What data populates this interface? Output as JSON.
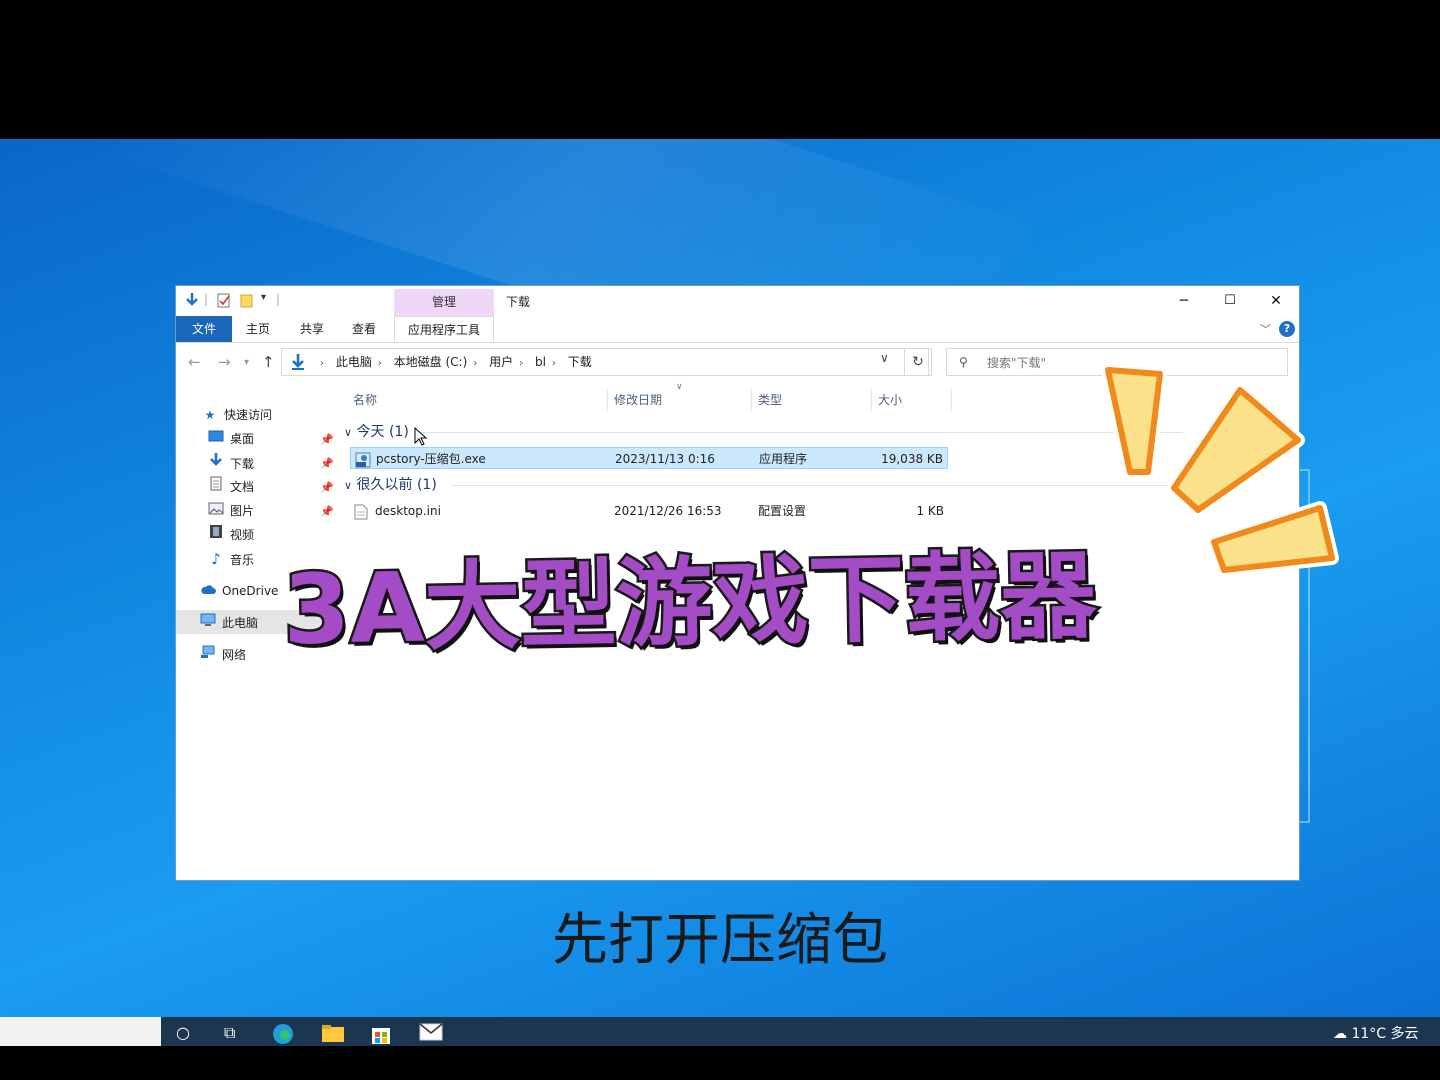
{
  "window": {
    "title": "下载",
    "context_tab_group": "管理",
    "controls": {
      "minimize": "─",
      "maximize": "☐",
      "close": "✕"
    }
  },
  "ribbon": {
    "tabs": [
      "文件",
      "主页",
      "共享",
      "查看",
      "应用程序工具"
    ],
    "help": "?"
  },
  "address": {
    "crumbs": [
      "此电脑",
      "本地磁盘 (C:)",
      "用户",
      "bl",
      "下载"
    ]
  },
  "search": {
    "placeholder": "搜索\"下载\""
  },
  "sidebar": {
    "items": [
      {
        "label": "快速访问",
        "icon": "star-icon",
        "pinned": false
      },
      {
        "label": "桌面",
        "icon": "desktop-icon",
        "pinned": true
      },
      {
        "label": "下载",
        "icon": "download-icon",
        "pinned": true
      },
      {
        "label": "文档",
        "icon": "document-icon",
        "pinned": true
      },
      {
        "label": "图片",
        "icon": "picture-icon",
        "pinned": true
      },
      {
        "label": "视频",
        "icon": "video-icon",
        "pinned": false
      },
      {
        "label": "音乐",
        "icon": "music-icon",
        "pinned": false
      },
      {
        "label": "OneDrive",
        "icon": "cloud-icon",
        "pinned": false
      },
      {
        "label": "此电脑",
        "icon": "computer-icon",
        "pinned": false,
        "selected": true
      },
      {
        "label": "网络",
        "icon": "network-icon",
        "pinned": false
      }
    ]
  },
  "list": {
    "headers": [
      "名称",
      "修改日期",
      "类型",
      "大小"
    ],
    "groups": [
      {
        "label": "今天 (1)",
        "files": [
          {
            "name": "pcstory-压缩包.exe",
            "date": "2023/11/13 0:16",
            "type": "应用程序",
            "size": "19,038 KB",
            "icon": "exe-icon",
            "selected": true
          }
        ]
      },
      {
        "label": "很久以前 (1)",
        "files": [
          {
            "name": "desktop.ini",
            "date": "2021/12/26 16:53",
            "type": "配置设置",
            "size": "1 KB",
            "icon": "ini-file-icon",
            "selected": false
          }
        ]
      }
    ]
  },
  "overlay": {
    "headline": "3A大型游戏下载器",
    "subtitle": "先打开压缩包"
  },
  "taskbar": {
    "weather": "11°C 多云"
  },
  "colors": {
    "accent": "#1a66b8",
    "overlay_text": "#a44bc6",
    "selection": "#cce8ff",
    "desktop": "#1189e0"
  }
}
